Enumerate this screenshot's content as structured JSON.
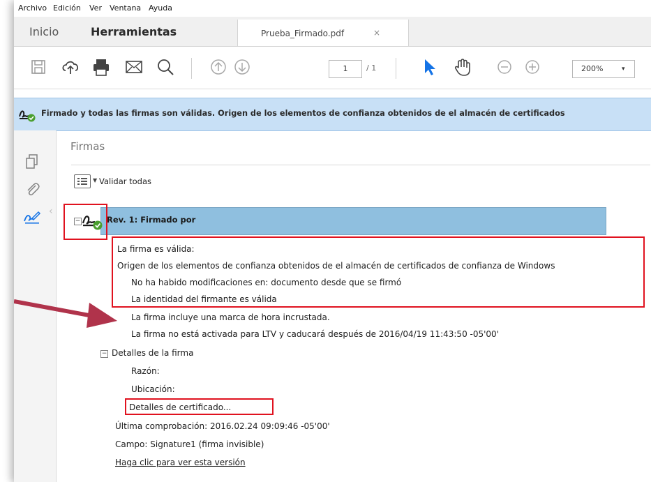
{
  "menu": {
    "items": [
      "Archivo",
      "Edición",
      "Ver",
      "Ventana",
      "Ayuda"
    ]
  },
  "tabs": {
    "home": "Inicio",
    "tools": "Herramientas",
    "document": "Prueba_Firmado.pdf",
    "close_symbol": "×"
  },
  "toolbar": {
    "icons": [
      "save-icon",
      "upload-icon",
      "print-icon",
      "email-icon",
      "search-icon",
      "page-up-icon",
      "page-down-icon",
      "select-cursor-icon",
      "hand-tool-icon",
      "zoom-out-icon",
      "zoom-in-icon"
    ],
    "page_current": "1",
    "page_total": "/ 1",
    "zoom": "200%",
    "zoom_caret": "▾",
    "accent_color": "#1473e6"
  },
  "message_bar": {
    "text": "Firmado y todas las firmas son válidas. Origen de los elementos de confianza obtenidos de el almacén de certificados",
    "background": "#c8e0f6"
  },
  "rail": {
    "icons": [
      "pages-icon",
      "attachment-icon",
      "signature-icon"
    ]
  },
  "signatures_panel": {
    "title": "Firmas",
    "validate_all": "Validar todas",
    "revision": {
      "label": "Rev. 1: Firmado por",
      "status_lines": [
        "La firma es válida:",
        "Origen de los elementos de confianza obtenidos de el almacén de certificados de confianza de Windows",
        "No ha habido modificaciones en: documento desde que se firmó",
        "La identidad del firmante es válida",
        "La firma incluye una marca de hora incrustada.",
        "La firma no está activada para LTV y caducará después de 2016/04/19 11:43:50 -05'00'"
      ],
      "details": {
        "label": "Detalles de la firma",
        "reason": "Razón:",
        "location": "Ubicación:",
        "certificate_link": "Detalles de certificado..."
      },
      "last_check": "Última comprobación: 2016.02.24 09:09:46 -05'00'",
      "field": "Campo: Signature1 (firma invisible)",
      "view_version_link": "Haga clic para ver esta versión"
    }
  },
  "annotation_colors": {
    "highlight_box": "#e0121f",
    "arrow": "#b0334b"
  }
}
